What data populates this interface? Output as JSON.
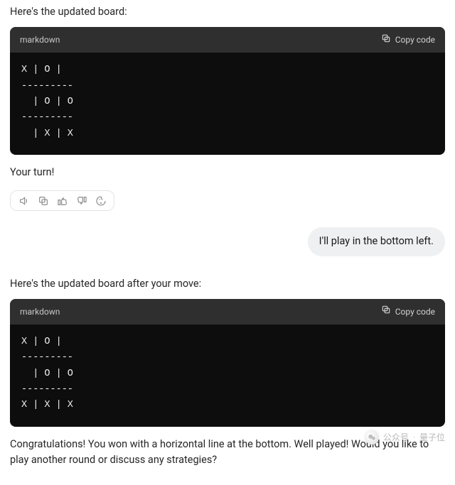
{
  "assistant1": {
    "intro": "Here's the updated board:",
    "code": {
      "lang": "markdown",
      "copy_label": "Copy code",
      "content": "X | O |  \n---------\n  | O | O\n---------\n  | X | X"
    },
    "outro": "Your turn!"
  },
  "actions": {
    "speak_name": "speak-icon",
    "copy_name": "copy-icon",
    "thumbs_up_name": "thumbs-up-icon",
    "thumbs_down_name": "thumbs-down-icon",
    "regenerate_name": "regenerate-icon"
  },
  "user1": {
    "text": "I'll play in the bottom left."
  },
  "assistant2": {
    "intro": "Here's the updated board after your move:",
    "code": {
      "lang": "markdown",
      "copy_label": "Copy code",
      "content": "X | O |  \n---------\n  | O | O\n---------\nX | X | X"
    },
    "outro": "Congratulations! You won with a horizontal line at the bottom. Well played! Would you like to play another round or discuss any strategies?"
  },
  "watermark": {
    "label": "公众号",
    "name": "量子位"
  }
}
